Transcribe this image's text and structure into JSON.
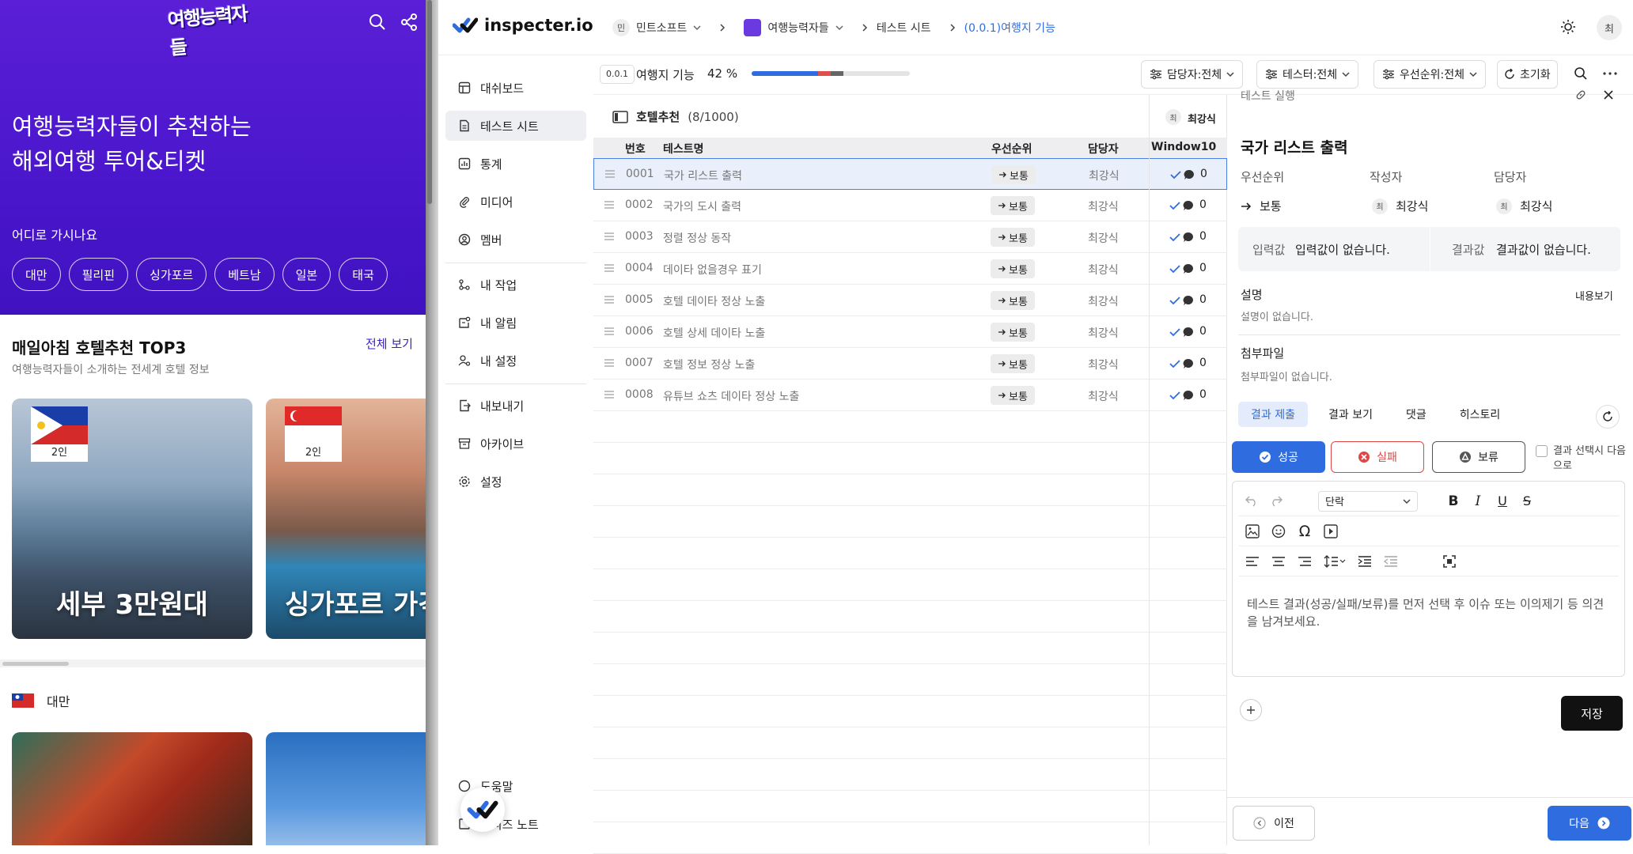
{
  "travel": {
    "logo": "여행능력자들",
    "hero_title": "여행능력자들이 추천하는\n해외여행 투어&티켓",
    "hero_sub": "어디로 가시나요",
    "chips": [
      "대만",
      "필리핀",
      "싱가포르",
      "베트남",
      "일본",
      "태국"
    ],
    "top3_title": "매일아침 호텔추천 TOP3",
    "top3_desc": "여행능력자들이 소개하는 전세계 호텔 정보",
    "top3_all": "전체 보기",
    "cards": [
      {
        "badge": "2인",
        "title": "세부 3만원대"
      },
      {
        "badge": "2인",
        "title": "싱가포르 가격"
      }
    ],
    "country": "대만"
  },
  "app": {
    "brand": "inspecter.io",
    "breadcrumb": [
      {
        "badge": "민",
        "label": "민트소프트"
      },
      {
        "badge": "",
        "label": "여행능력자들"
      },
      {
        "label": "테스트 시트"
      },
      {
        "label": "(0.0.1)여행지 기능"
      }
    ],
    "avatar": "최",
    "sidebar": {
      "items": [
        "대쉬보드",
        "테스트 시트",
        "통계",
        "미디어",
        "멤버",
        "내 작업",
        "내 알림",
        "내 설정",
        "내보내기",
        "아카이브",
        "설정",
        "도움말",
        "릴리즈 노트"
      ],
      "active": 1
    },
    "toolbar": {
      "version": "0.0.1",
      "version_name": "여행지 기능",
      "progress_label": "42 %",
      "progress": {
        "success": 0.42,
        "fail": 0.08,
        "hold": 0.08
      },
      "filters": [
        "담당자:전체",
        "테스터:전체",
        "우선순위:전체"
      ],
      "reset": "초기화"
    },
    "table": {
      "suite": "호텔추천",
      "suite_count": "(8/1000)",
      "columns": [
        "번호",
        "테스트명",
        "우선순위",
        "담당자",
        "Window10"
      ],
      "env_user_badge": "최",
      "env_user": "최강식",
      "rows": [
        {
          "no": "0001",
          "name": "국가 리스트 출력",
          "priority": "보통",
          "assignee": "최강식",
          "comments": "0"
        },
        {
          "no": "0002",
          "name": "국가의 도시 출력",
          "priority": "보통",
          "assignee": "최강식",
          "comments": "0"
        },
        {
          "no": "0003",
          "name": "정렬 정상 동작",
          "priority": "보통",
          "assignee": "최강식",
          "comments": "0"
        },
        {
          "no": "0004",
          "name": "데이타 없을경우 표기",
          "priority": "보통",
          "assignee": "최강식",
          "comments": "0"
        },
        {
          "no": "0005",
          "name": "호텔 데이타 정상 노출",
          "priority": "보통",
          "assignee": "최강식",
          "comments": "0"
        },
        {
          "no": "0006",
          "name": "호텔 상세 데이타 노출",
          "priority": "보통",
          "assignee": "최강식",
          "comments": "0"
        },
        {
          "no": "0007",
          "name": "호텔 정보 정상 노출",
          "priority": "보통",
          "assignee": "최강식",
          "comments": "0"
        },
        {
          "no": "0008",
          "name": "유튜브 쇼츠 데이타 정상 노출",
          "priority": "보통",
          "assignee": "최강식",
          "comments": "0"
        }
      ]
    },
    "panel": {
      "header": "테스트 실행",
      "title": "국가 리스트 출력",
      "priority_label": "우선순위",
      "priority_value": "보통",
      "author_label": "작성자",
      "author_badge": "최",
      "author_value": "최강식",
      "assignee_label": "담당자",
      "assignee_badge": "최",
      "assignee_value": "최강식",
      "input_label": "입력값",
      "input_value": "입력값이 없습니다.",
      "result_label": "결과값",
      "result_value": "결과값이 없습니다.",
      "desc_label": "설명",
      "desc_more": "내용보기",
      "desc_value": "설명이 없습니다.",
      "attach_label": "첨부파일",
      "attach_value": "첨부파일이 없습니다.",
      "tabs": [
        "결과 제출",
        "결과 보기",
        "댓글",
        "히스토리"
      ],
      "btn_success": "성공",
      "btn_fail": "실패",
      "btn_hold": "보류",
      "auto_next": "결과 선택시 다음으로",
      "paragraph": "단락",
      "placeholder": "테스트 결과(성공/실패/보류)를 먼저 선택 후 이슈 또는 이의제기 등 의견을 남겨보세요.",
      "save": "저장",
      "prev": "이전",
      "next": "다음"
    }
  }
}
